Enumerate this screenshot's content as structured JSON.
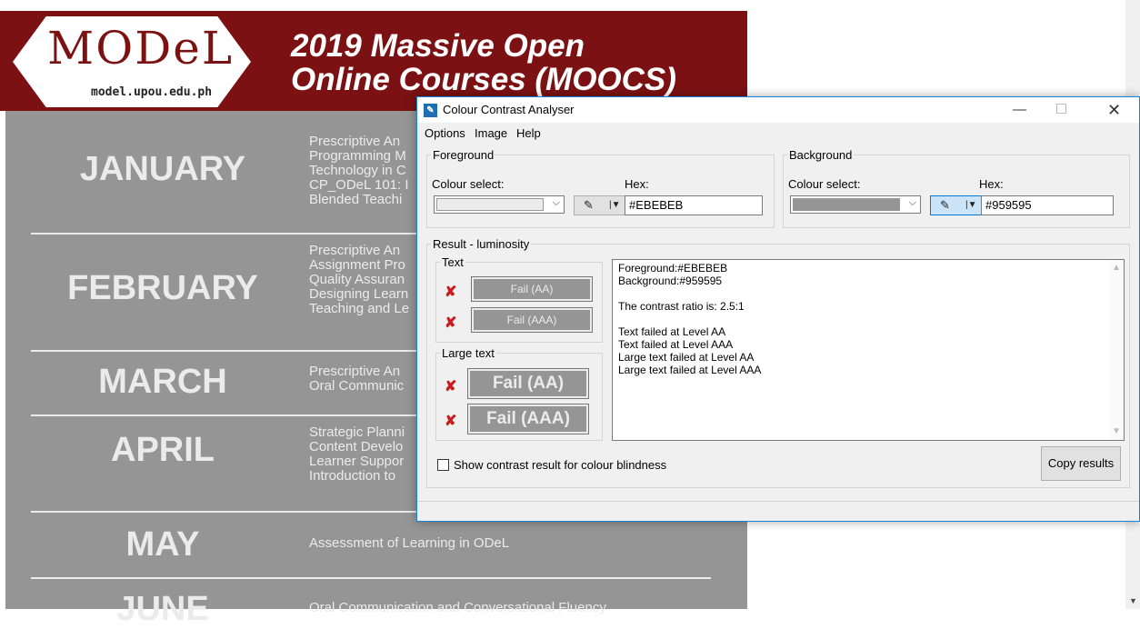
{
  "poster": {
    "logo_text": "MODeL",
    "logo_url": "model.upou.edu.ph",
    "title_line1": "2019 Massive Open",
    "title_line2": "Online Courses (MOOCS)",
    "months": [
      {
        "name": "JANUARY",
        "courses": "Prescriptive An\nProgramming M\nTechnology in C\nCP_ODeL 101: I\nBlended Teachi"
      },
      {
        "name": "FEBRUARY",
        "courses": "Prescriptive An\nAssignment Pro\nQuality Assuran\nDesigning Learn\nTeaching and Le"
      },
      {
        "name": "MARCH",
        "courses": "Prescriptive An\nOral Communic"
      },
      {
        "name": "APRIL",
        "courses": "Strategic Planni\nContent Develo\nLearner Suppor\nIntroduction to"
      },
      {
        "name": "MAY",
        "courses": "Assessment of Learning in ODeL"
      },
      {
        "name": "JUNE",
        "courses": "Oral Communication and Conversational Fluency"
      }
    ]
  },
  "dialog": {
    "title": "Colour Contrast Analyser",
    "menu": [
      "Options",
      "Image",
      "Help"
    ],
    "foreground": {
      "legend": "Foreground",
      "colour_select_label": "Colour select:",
      "hex_label": "Hex:",
      "hex_value": "#EBEBEB",
      "swatch_color": "#EBEBEB"
    },
    "background": {
      "legend": "Background",
      "colour_select_label": "Colour select:",
      "hex_label": "Hex:",
      "hex_value": "#959595",
      "swatch_color": "#959595"
    },
    "result": {
      "legend": "Result - luminosity",
      "text_legend": "Text",
      "large_text_legend": "Large text",
      "text_aa": "Fail (AA)",
      "text_aaa": "Fail (AAA)",
      "large_aa": "Fail (AA)",
      "large_aaa": "Fail (AAA)",
      "lines": [
        "Foreground:#EBEBEB",
        "Background:#959595",
        "",
        "The contrast ratio is: 2.5:1",
        "",
        "Text failed at Level AA",
        "Text failed at Level AAA",
        "Large text failed at Level AA",
        "Large text failed at Level AAA"
      ]
    },
    "colour_blindness_label": "Show contrast result for colour blindness",
    "colour_blindness_checked": false,
    "copy_button": "Copy results"
  },
  "colors": {
    "brand": "#7b1113",
    "poster_grey": "#959595",
    "poster_text": "#ebebeb",
    "fail_mark": "#c81e1e"
  }
}
